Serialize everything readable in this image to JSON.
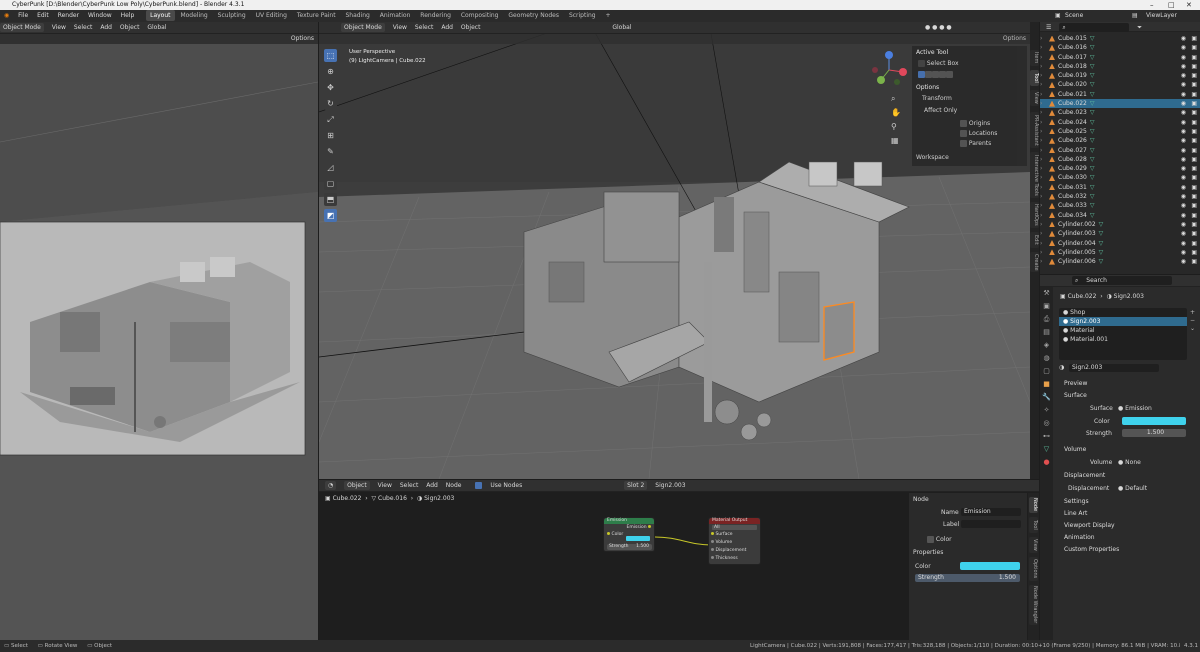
{
  "title": "CyberPunk [D:\\Blender\\CyberPunk Low Poly\\CyberPunk.blend] - Blender 4.3.1",
  "menus": [
    "File",
    "Edit",
    "Render",
    "Window",
    "Help"
  ],
  "workspaces": [
    "Layout",
    "Modeling",
    "Sculpting",
    "UV Editing",
    "Texture Paint",
    "Shading",
    "Animation",
    "Rendering",
    "Compositing",
    "Geometry Nodes",
    "Scripting"
  ],
  "scene": {
    "name": "Scene",
    "view_layer": "ViewLayer"
  },
  "left_view": {
    "mode": "Object Mode",
    "view": "View",
    "select": "Select",
    "add": "Add",
    "object": "Object",
    "orientation": "Global",
    "options": "Options"
  },
  "viewport": {
    "mode": "Object Mode",
    "view": "View",
    "select": "Select",
    "add": "Add",
    "object": "Object",
    "orientation": "Global",
    "options": "Options",
    "perspective": "User Perspective",
    "context": "(9) LightCamera | Cube.022"
  },
  "tool_panel": {
    "active_tool": "Active Tool",
    "select_box": "Select Box",
    "options": "Options",
    "transform": "Transform",
    "affect_only": "Affect Only",
    "origins": "Origins",
    "locations": "Locations",
    "parents": "Parents",
    "workspace": "Workspace"
  },
  "side_tabs": [
    "Item",
    "Tool",
    "View",
    "PR-Assistant",
    "Interactive Tools",
    "HardOps",
    "Edit",
    "Create"
  ],
  "outliner": [
    {
      "name": "Cube.015"
    },
    {
      "name": "Cube.016"
    },
    {
      "name": "Cube.017"
    },
    {
      "name": "Cube.018"
    },
    {
      "name": "Cube.019"
    },
    {
      "name": "Cube.020"
    },
    {
      "name": "Cube.021"
    },
    {
      "name": "Cube.022",
      "selected": true
    },
    {
      "name": "Cube.023"
    },
    {
      "name": "Cube.024"
    },
    {
      "name": "Cube.025"
    },
    {
      "name": "Cube.026"
    },
    {
      "name": "Cube.027"
    },
    {
      "name": "Cube.028"
    },
    {
      "name": "Cube.029"
    },
    {
      "name": "Cube.030"
    },
    {
      "name": "Cube.031"
    },
    {
      "name": "Cube.032"
    },
    {
      "name": "Cube.033"
    },
    {
      "name": "Cube.034"
    },
    {
      "name": "Cylinder.002"
    },
    {
      "name": "Cylinder.003"
    },
    {
      "name": "Cylinder.004"
    },
    {
      "name": "Cylinder.005"
    },
    {
      "name": "Cylinder.006"
    }
  ],
  "properties": {
    "search": "Search",
    "object": "Cube.022",
    "material": "Sign2.003",
    "slots": [
      "Shop",
      "Sign2.003",
      "Material",
      "Material.001"
    ],
    "material_field": "Sign2.003",
    "preview": "Preview",
    "surface": "Surface",
    "surface_label": "Surface",
    "surface_value": "Emission",
    "color_label": "Color",
    "strength_label": "Strength",
    "strength_value": "1.500",
    "volume": "Volume",
    "volume_label": "Volume",
    "volume_value": "None",
    "displacement": "Displacement",
    "disp_label": "Displacement",
    "disp_value": "Default",
    "settings": "Settings",
    "line_art": "Line Art",
    "viewport_display": "Viewport Display",
    "animation": "Animation",
    "custom_props": "Custom Properties"
  },
  "node_editor": {
    "type": "Object",
    "view": "View",
    "select": "Select",
    "add": "Add",
    "node": "Node",
    "use_nodes": "Use Nodes",
    "slot": "Slot 2",
    "material": "Sign2.003",
    "breadcrumb": [
      "Cube.022",
      "Cube.016",
      "Sign2.003"
    ],
    "emission": {
      "title": "Emission",
      "out": "Emission",
      "color": "Color",
      "strength_label": "Strength",
      "strength": "1.500"
    },
    "output": {
      "title": "Material Output",
      "target": "All",
      "inputs": [
        "Surface",
        "Volume",
        "Displacement",
        "Thickness"
      ]
    },
    "panel": {
      "node": "Node",
      "name_label": "Name",
      "name": "Emission",
      "label_label": "Label",
      "color": "Color",
      "properties": "Properties",
      "color_label": "Color",
      "strength_label": "Strength",
      "strength": "1.500"
    },
    "side_tabs": [
      "Node",
      "Tool",
      "View",
      "Options",
      "Node Wrangler"
    ]
  },
  "status": {
    "select": "Select",
    "rotate": "Rotate View",
    "object": "Object",
    "stats": "LightCamera | Cube.022 | Verts:191,808 | Faces:177,417 | Tris:328,188 | Objects:1/110 | Duration: 00:10+10 (Frame 9/250) | Memory: 86.1 MiB | VRAM: 10.8/48 GiB",
    "version": "4.3.1"
  }
}
